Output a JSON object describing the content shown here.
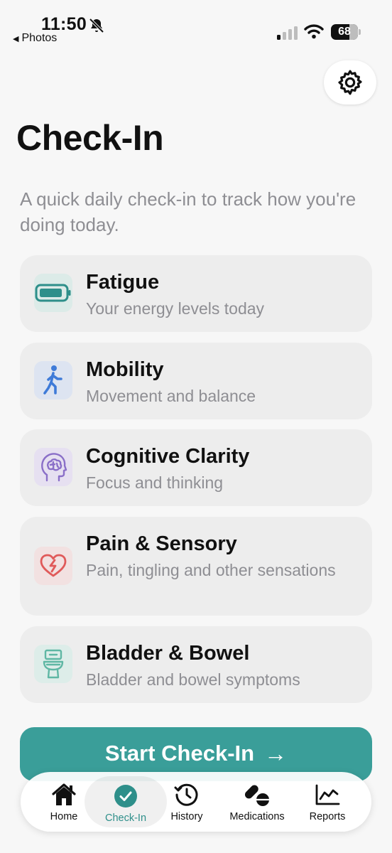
{
  "status": {
    "time": "11:50",
    "back_label": "Photos",
    "battery": "68",
    "battery_level": 0.68
  },
  "header": {
    "title": "Check-In",
    "subtitle": "A quick daily check-in to track how you're doing today.",
    "settings_icon": "gear-icon"
  },
  "categories": [
    {
      "title": "Fatigue",
      "description": "Your energy levels today",
      "icon": "battery-icon",
      "tint": "#DCEBE8",
      "color": "#2E8F8A"
    },
    {
      "title": "Mobility",
      "description": "Movement and balance",
      "icon": "walking-icon",
      "tint": "#DDE4F1",
      "color": "#3F7BD8"
    },
    {
      "title": "Cognitive Clarity",
      "description": "Focus and thinking",
      "icon": "brain-head-icon",
      "tint": "#E6E0F1",
      "color": "#8A6FC8"
    },
    {
      "title": "Pain & Sensory",
      "description": "Pain, tingling and other sensations",
      "icon": "heart-bolt-icon",
      "tint": "#F2E1E1",
      "color": "#E05A5A"
    },
    {
      "title": "Bladder & Bowel",
      "description": "Bladder and bowel symptoms",
      "icon": "toilet-icon",
      "tint": "#DDEDE9",
      "color": "#5FB7A4"
    }
  ],
  "cta": {
    "label": "Start Check-In",
    "arrow": "→"
  },
  "tabs": [
    {
      "label": "Home",
      "icon": "house-icon"
    },
    {
      "label": "Check-In",
      "icon": "checkmark-circle-icon",
      "active": true
    },
    {
      "label": "History",
      "icon": "clock-history-icon"
    },
    {
      "label": "Medications",
      "icon": "pills-icon"
    },
    {
      "label": "Reports",
      "icon": "chart-line-icon"
    }
  ],
  "colors": {
    "accent": "#3A9E99",
    "background": "#F7F7F7",
    "card": "#EDEDED",
    "secondary_text": "#8E8E93"
  }
}
